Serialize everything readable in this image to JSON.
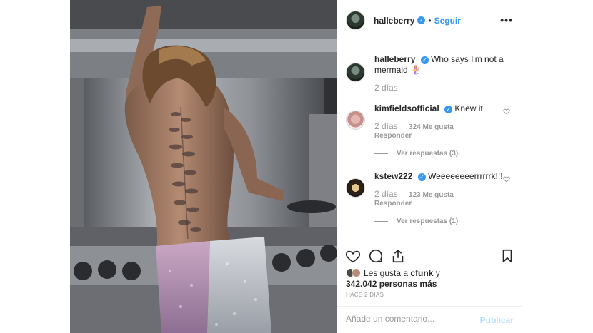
{
  "post": {
    "author": "halleberry",
    "follow_label": "Seguir",
    "separator": "•",
    "more_glyph": "•••",
    "caption": {
      "user": "halleberry",
      "text": "Who says I'm not a mermaid 🧜‍♀️",
      "time": "2 días"
    },
    "comments": [
      {
        "user": "kimfieldsofficial",
        "text": "Knew it",
        "time": "2 días",
        "likes": "324 Me gusta",
        "reply_label": "Responder",
        "view_replies": "Ver respuestas (3)"
      },
      {
        "user": "kstew222",
        "text": "Weeeeeeeerrrrrrk!!!",
        "time": "2 días",
        "likes": "123 Me gusta",
        "reply_label": "Responder",
        "view_replies": "Ver respuestas (1)"
      }
    ],
    "liked_by_prefix": "Les gusta a",
    "liked_by_user": "cfunk",
    "liked_by_suffix": "y",
    "likes_count": "342.042 personas más",
    "time_ago": "HACE 2 DÍAS",
    "comment_placeholder": "Añade un comentario...",
    "publish_label": "Publicar"
  },
  "icons": {
    "like": "heart-icon",
    "comment": "comment-icon",
    "share": "share-icon",
    "save": "bookmark-icon",
    "verified": "verified-badge-icon",
    "more": "more-options-icon"
  },
  "colors": {
    "link_blue": "#3897f0",
    "muted_text": "#999999",
    "disabled_publish": "#b2dffc",
    "verified_blue": "#3897f0"
  }
}
